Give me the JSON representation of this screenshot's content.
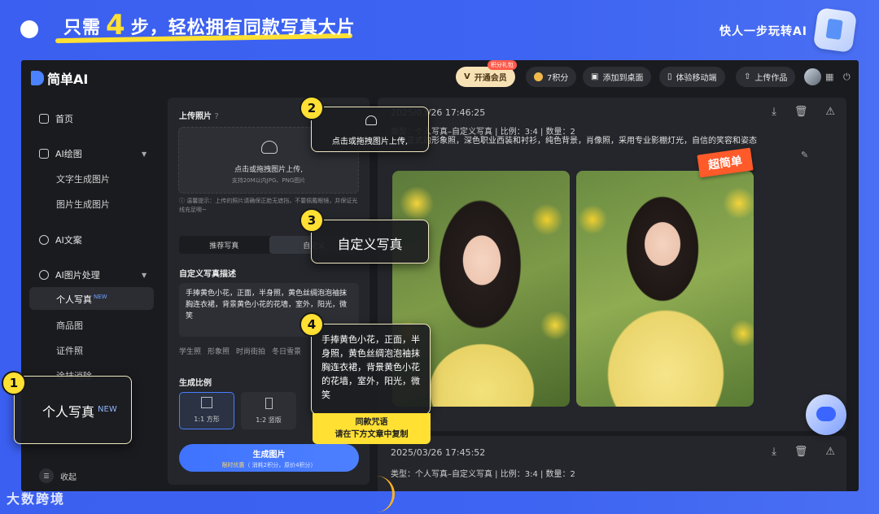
{
  "promo": {
    "headline_pre": "只需",
    "headline_num": "4",
    "headline_post": "步，轻松拥有同款写真大片",
    "brand_tag": "快人一步玩转AI",
    "watermark": "大数跨境"
  },
  "topbar": {
    "logo": "简单AI",
    "vip_label": "开通会员",
    "vip_badge": "积分礼包",
    "points_label": "7积分",
    "desktop_label": "添加到桌面",
    "mobile_label": "体验移动端",
    "upload_works_label": "上传作品"
  },
  "sidebar": {
    "home": "首页",
    "ai_draw": "AI绘图",
    "text2img": "文字生成图片",
    "img2img": "图片生成图片",
    "ai_text": "AI文案",
    "ai_image_proc": "AI图片处理",
    "personal_photo": "个人写真",
    "new_badge": "NEW",
    "product_img": "商品图",
    "id_photo": "证件照",
    "erase": "涂抹消除",
    "collapse": "收起"
  },
  "panel": {
    "upload_label": "上传照片",
    "upload_help": "?",
    "upload_main": "点击或拖拽图片上传,",
    "upload_sub": "支持20M以内JPG、PNG图片",
    "tip": "ⓘ 温馨提示：上传的照片请确保正脸无遮挡，不要佩戴眼镜，并保证光线充足噢~",
    "tab_recommend": "推荐写真",
    "tab_custom": "自定义",
    "desc_label": "自定义写真描述",
    "desc_text": "手捧黄色小花，正面，半身照，黄色丝绸泡泡袖抹胸连衣裙，背景黄色小花的花墙，室外，阳光，微笑",
    "tags": [
      "学生照",
      "形象照",
      "时尚街拍",
      "冬日雪景"
    ],
    "ratio_label": "生成比例",
    "ratio_1": "1:1 方形",
    "ratio_2": "1:2 竖版",
    "gen_button": "生成图片",
    "gen_sub_pre": "限时优惠",
    "gen_sub_post": "（ 消耗2积分，原价4积分）"
  },
  "results": {
    "ts1": "2025/03/26 17:46:25",
    "meta1": "类型：个人写真–自定义写真 | 比例：3:4 | 数量：2",
    "prompt1": "一张正式的形象照，深色职业西装和衬衫，纯色背景，肖像照，采用专业影棚灯光，自信的笑容和姿态",
    "ts2": "2025/03/26 17:45:52",
    "meta2": "类型：个人写真–自定义写真 | 比例：3:4 | 数量：2",
    "super_label": "超简单"
  },
  "callouts": {
    "step1_num": "1",
    "step1_text": "个人写真",
    "step1_badge": "NEW",
    "step2_num": "2",
    "step2_text": "点击或拖拽图片上传,",
    "step3_num": "3",
    "step3_text": "自定义写真",
    "step4_num": "4",
    "step4_text": "手捧黄色小花，正面，半身照，黄色丝绸泡泡袖抹胸连衣裙，背景黄色小花的花墙，室外，阳光，微笑",
    "copy_line1": "同款咒语",
    "copy_line2": "请在下方文章中复制"
  },
  "colors": {
    "promo_bg": "#3b5ff0",
    "accent_yellow": "#ffe033",
    "app_bg": "#1a1b1f",
    "primary_blue": "#4b7dff"
  }
}
